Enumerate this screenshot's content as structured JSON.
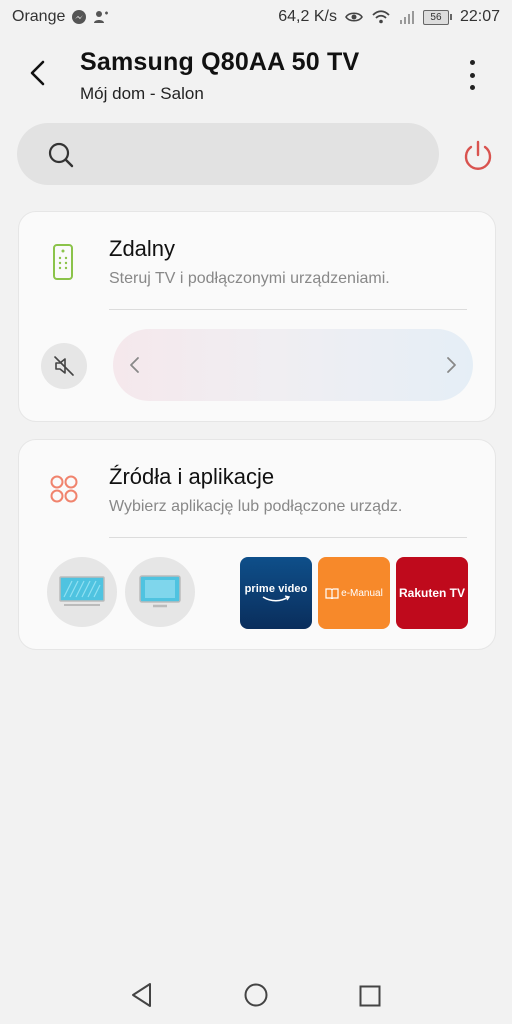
{
  "status_bar": {
    "carrier": "Orange",
    "speed": "64,2 K/s",
    "battery": "56",
    "time": "22:07"
  },
  "header": {
    "title": "Samsung Q80AA 50 TV",
    "subtitle": "Mój dom - Salon"
  },
  "search": {
    "placeholder": ""
  },
  "remote_card": {
    "title": "Zdalny",
    "subtitle": "Steruj TV i podłączonymi urządzeniami."
  },
  "sources_card": {
    "title": "Źródła i aplikacje",
    "subtitle": "Wybierz aplikację lub podłączone urządz.",
    "apps": [
      {
        "label": "prime video"
      },
      {
        "label": "e-Manual"
      },
      {
        "label": "Rakuten TV"
      }
    ]
  },
  "colors": {
    "power": "#d9534f",
    "remote_icon": "#8bc34a",
    "sources_icon": "#f0836d"
  }
}
